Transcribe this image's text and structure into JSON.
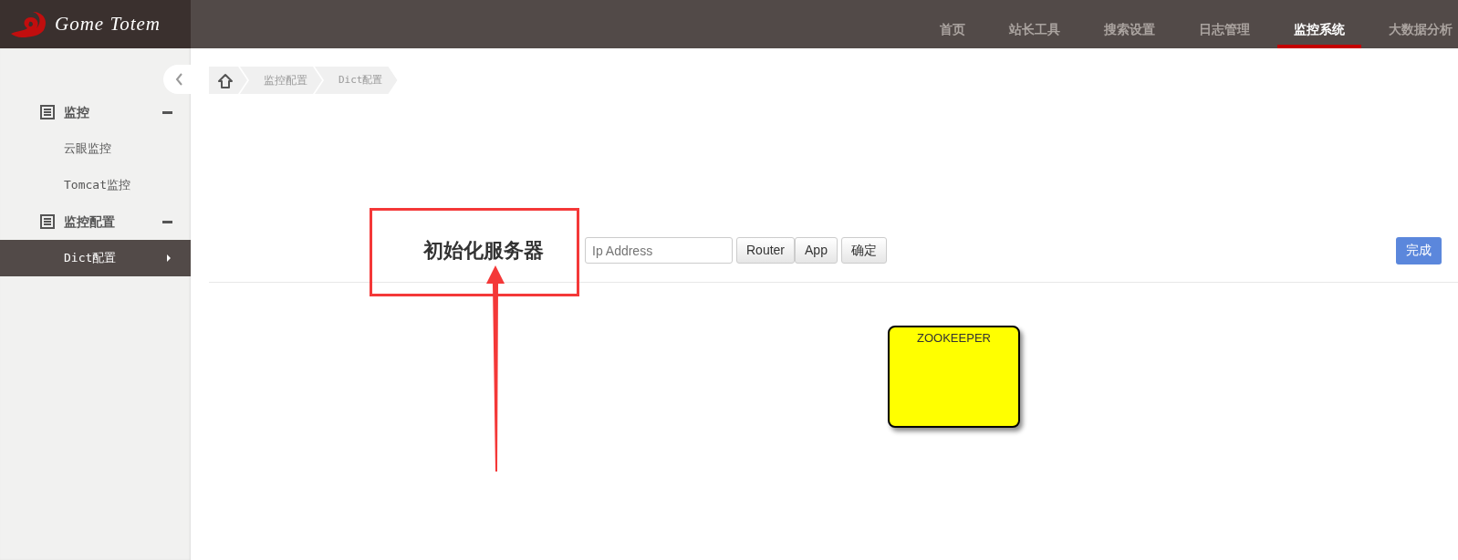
{
  "brand": {
    "name": "Gome Totem"
  },
  "nav": [
    {
      "label": "首页",
      "selected": false
    },
    {
      "label": "站长工具",
      "selected": false
    },
    {
      "label": "搜索设置",
      "selected": false
    },
    {
      "label": "日志管理",
      "selected": false
    },
    {
      "label": "监控系统",
      "selected": true
    },
    {
      "label": "大数据分析",
      "selected": false
    }
  ],
  "sidebar": {
    "groups": [
      {
        "label": "监控",
        "expanded": true,
        "children": [
          {
            "label": "云眼监控",
            "selected": false
          },
          {
            "label": "Tomcat监控",
            "selected": false
          }
        ]
      },
      {
        "label": "监控配置",
        "expanded": true,
        "children": [
          {
            "label": "Dict配置",
            "selected": true
          }
        ]
      }
    ]
  },
  "breadcrumb": [
    "监控配置",
    "Dict配置"
  ],
  "toolbar": {
    "title": "初始化服务器",
    "ip_field": {
      "placeholder": "Ip Address"
    },
    "type_buttons": [
      "Router",
      "App"
    ],
    "confirm_button": "确定",
    "done_button": "完成"
  },
  "canvas": {
    "nodes": [
      {
        "label": "ZOOKEEPER"
      }
    ]
  }
}
